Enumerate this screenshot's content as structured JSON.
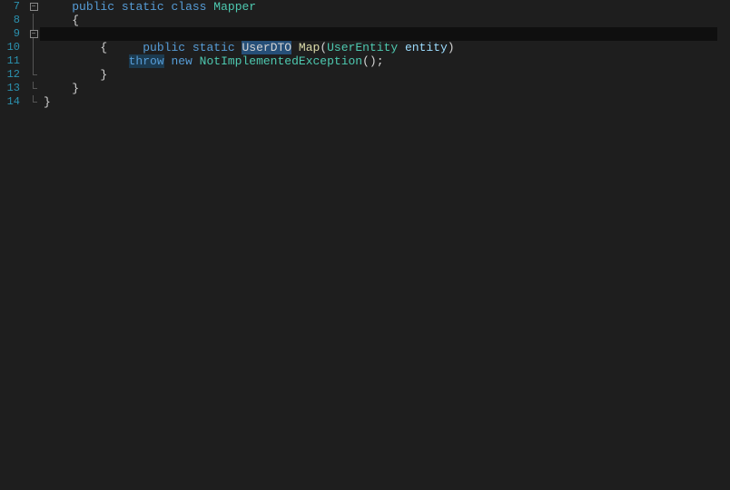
{
  "editor": {
    "current_line_index": 2,
    "line_numbers": [
      "7",
      "8",
      "9",
      "10",
      "11",
      "12",
      "13",
      "14"
    ],
    "fold": [
      {
        "type": "box",
        "sym": "−"
      },
      {
        "type": "line"
      },
      {
        "type": "box",
        "sym": "−"
      },
      {
        "type": "line"
      },
      {
        "type": "line"
      },
      {
        "type": "corner"
      },
      {
        "type": "corner"
      },
      {
        "type": "corner"
      }
    ],
    "lines": {
      "l7": {
        "indent": "    ",
        "kw1": "public",
        "sp1": " ",
        "kw2": "static",
        "sp2": " ",
        "kw3": "class",
        "sp3": " ",
        "type": "Mapper"
      },
      "l8": {
        "text": "    {"
      },
      "l9": {
        "indent": "        ",
        "kw1": "public",
        "sp1": " ",
        "kw2": "static",
        "sp2": " ",
        "sel_type": "UserDTO",
        "sp3": " ",
        "method": "Map",
        "paren_o": "(",
        "ptype": "UserEntity",
        "sp4": " ",
        "pname": "entity",
        "paren_c": ")"
      },
      "l10": {
        "text": "        {"
      },
      "l11": {
        "indent": "            ",
        "throw": "throw",
        "sp1": " ",
        "new": "new",
        "sp2": " ",
        "ex": "NotImplementedException",
        "tail": "();"
      },
      "l12": {
        "text": "        }"
      },
      "l13": {
        "text": "    }"
      },
      "l14": {
        "text": "}"
      }
    }
  }
}
